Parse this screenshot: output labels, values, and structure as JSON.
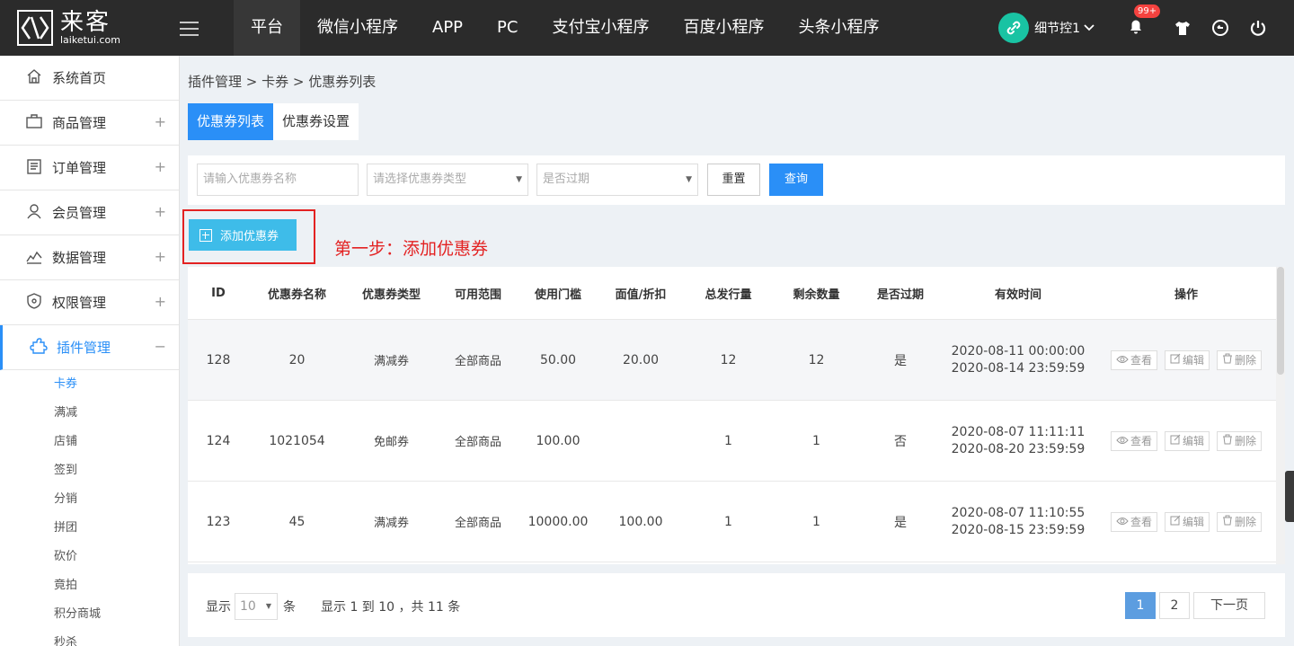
{
  "app": {
    "logo_cn": "来客",
    "logo_en": "laiketui.com"
  },
  "topnav": [
    "平台",
    "微信小程序",
    "APP",
    "PC",
    "支付宝小程序",
    "百度小程序",
    "头条小程序"
  ],
  "user": {
    "name": "细节控1",
    "badge": "99+"
  },
  "sidebar": {
    "items": [
      {
        "label": "系统首页",
        "icon": "home-icon"
      },
      {
        "label": "商品管理",
        "icon": "shop-icon"
      },
      {
        "label": "订单管理",
        "icon": "order-icon"
      },
      {
        "label": "会员管理",
        "icon": "member-icon"
      },
      {
        "label": "数据管理",
        "icon": "chart-icon"
      },
      {
        "label": "权限管理",
        "icon": "shield-icon"
      },
      {
        "label": "插件管理",
        "icon": "puzzle-icon"
      }
    ],
    "subitems": [
      "卡券",
      "满减",
      "店铺",
      "签到",
      "分销",
      "拼团",
      "砍价",
      "竟拍",
      "积分商城",
      "秒杀"
    ],
    "plus": "+",
    "minus": "−"
  },
  "breadcrumb": "插件管理 > 卡券 > 优惠券列表",
  "tabs": [
    "优惠券列表",
    "优惠券设置"
  ],
  "filter": {
    "name_placeholder": "请输入优惠券名称",
    "type_placeholder": "请选择优惠券类型",
    "expired_placeholder": "是否过期",
    "reset": "重置",
    "query": "查询"
  },
  "add_button": "添加优惠券",
  "step_note": "第一步：添加优惠券",
  "table": {
    "headers": [
      "ID",
      "优惠券名称",
      "优惠券类型",
      "可用范围",
      "使用门槛",
      "面值/折扣",
      "总发行量",
      "剩余数量",
      "是否过期",
      "有效时间",
      "操作"
    ],
    "rows": [
      {
        "id": "128",
        "name": "20",
        "type": "满减券",
        "scope": "全部商品",
        "threshold": "50.00",
        "value": "20.00",
        "total": "12",
        "remaining": "12",
        "expired": "是",
        "start": "2020-08-11 00:00:00",
        "end": "2020-08-14 23:59:59"
      },
      {
        "id": "124",
        "name": "1021054",
        "type": "免邮券",
        "scope": "全部商品",
        "threshold": "100.00",
        "value": "",
        "total": "1",
        "remaining": "1",
        "expired": "否",
        "start": "2020-08-07 11:11:11",
        "end": "2020-08-20 23:59:59"
      },
      {
        "id": "123",
        "name": "45",
        "type": "满减券",
        "scope": "全部商品",
        "threshold": "10000.00",
        "value": "100.00",
        "total": "1",
        "remaining": "1",
        "expired": "是",
        "start": "2020-08-07 11:10:55",
        "end": "2020-08-15 23:59:59"
      }
    ],
    "ops": {
      "view": "查看",
      "edit": "编辑",
      "delete": "删除"
    }
  },
  "footer": {
    "show": "显示",
    "page_size": "10",
    "unit": "条",
    "info": "显示 1 到 10 ，共 11 条",
    "pages": [
      "1",
      "2"
    ],
    "next": "下一页"
  },
  "colors": {
    "primary": "#2a8ff7",
    "add_button": "#3ebce9",
    "highlight_red": "#e32222",
    "topbar": "#2b2b2b"
  }
}
